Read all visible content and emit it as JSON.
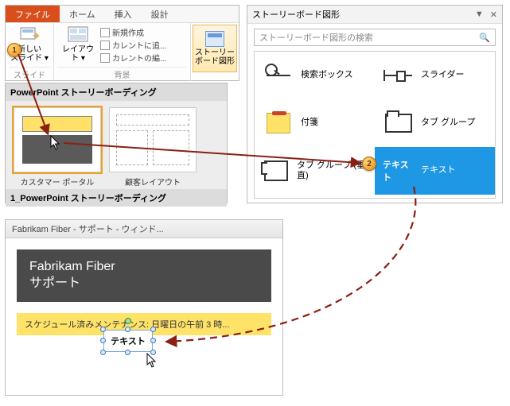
{
  "ribbon": {
    "tabs": {
      "file": "ファイル",
      "home": "ホーム",
      "insert": "挿入",
      "design": "設計"
    },
    "groups": {
      "slide": {
        "label": "スライド",
        "newslide": "新しい\nスライド ▾"
      },
      "background": {
        "label": "背景",
        "layout": "レイアウト ▾",
        "items": {
          "new": "新規作成",
          "addcurrent": "カレントに追...",
          "editcurrent": "カレントの編..."
        }
      },
      "sbshape": {
        "button": "ストーリーボード図形"
      }
    }
  },
  "thumbs": {
    "title": "PowerPoint ストーリーボーディング",
    "footer": "1_PowerPoint ストーリーボーディング",
    "items": [
      {
        "caption": "カスタマー ポータル"
      },
      {
        "caption": "顧客レイアウト"
      }
    ]
  },
  "pane": {
    "title": "ストーリーボード図形",
    "search_placeholder": "ストーリーボード図形の検索",
    "shapes": {
      "searchbox": "検索ボックス",
      "slider": "スライダー",
      "sticky": "付箋",
      "tabgroup": "タブ グループ",
      "vtabgroup": "タブ グループ (垂直)",
      "text_label": "テキスト",
      "text_sample": "テキスト"
    }
  },
  "preview": {
    "title": "Fabrikam Fiber - サポート - ウィンド...",
    "banner_line1": "Fabrikam Fiber",
    "banner_line2": "サポート",
    "maintenance": "スケジュール済みメンテナンス: 日曜日の午前 3 時...",
    "textshape": "テキスト"
  },
  "steps": {
    "s1": "1",
    "s2": "2"
  }
}
